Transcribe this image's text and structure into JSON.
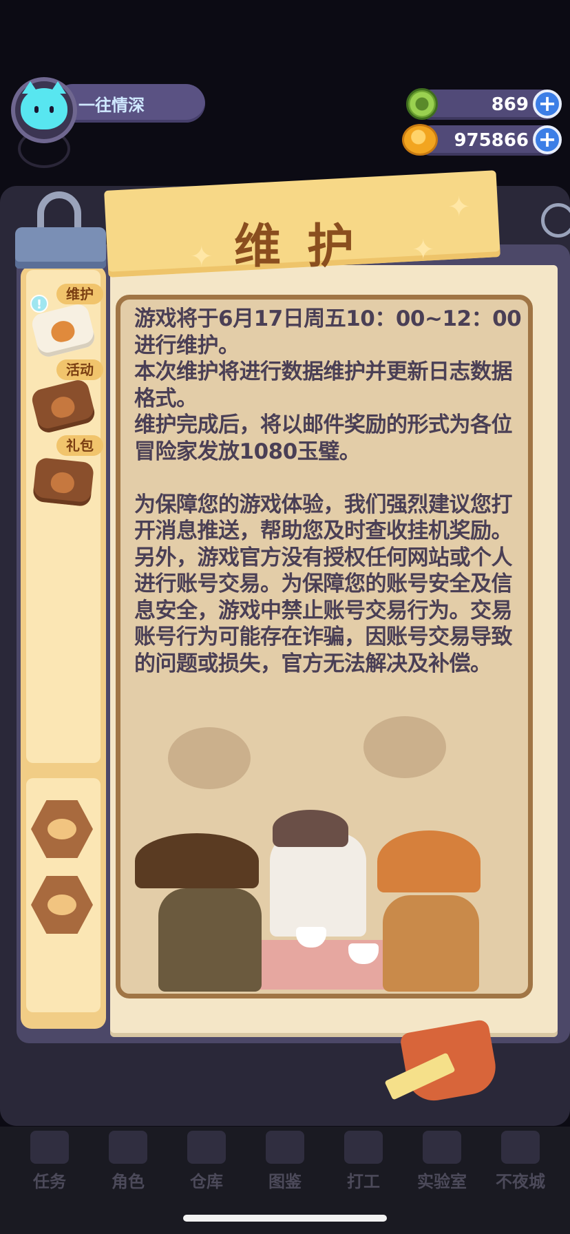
{
  "player": {
    "name": "一往情深"
  },
  "currencies": [
    {
      "icon": "green-gem-icon",
      "value": "869"
    },
    {
      "icon": "gold-coin-icon",
      "value": "975866"
    }
  ],
  "notice": {
    "title": "维护",
    "body": "游戏将于6月17日周五10：00~12：00进行维护。\n本次维护将进行数据维护并更新日志数据格式。\n维护完成后，将以邮件奖励的形式为各位冒险家发放1080玉璧。\n\n为保障您的游戏体验，我们强烈建议您打开消息推送，帮助您及时查收挂机奖励。\n另外，游戏官方没有授权任何网站或个人进行账号交易。为保障您的账号安全及信息安全，游戏中禁止账号交易行为。交易账号行为可能存在诈骗，因账号交易导致的问题或损失，官方无法解决及补偿。"
  },
  "tabs": [
    {
      "label": "维护",
      "active": true
    },
    {
      "label": "活动",
      "active": false
    },
    {
      "label": "礼包",
      "active": false
    }
  ],
  "side_buttons": [
    {
      "icon": "chat-bubble-icon"
    },
    {
      "icon": "weibo-icon"
    }
  ],
  "bottom_nav": [
    "任务",
    "角色",
    "仓库",
    "图鉴",
    "打工",
    "实验室",
    "不夜城"
  ],
  "colors": {
    "accent": "#f7d887",
    "title": "#8a4e1f",
    "text": "#4a3f55",
    "plus": "#3c7ee6"
  }
}
